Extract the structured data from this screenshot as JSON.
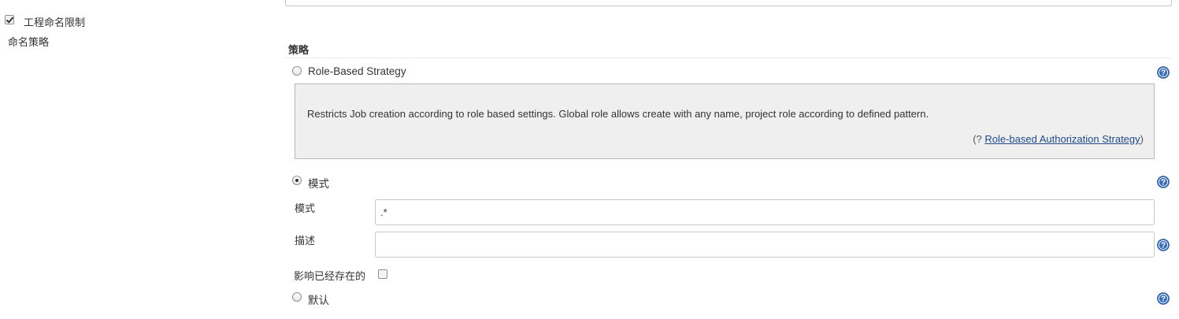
{
  "left_panel": {
    "checkbox_label": "工程命名限制",
    "checkbox_checked": true,
    "strategy_label": "命名策略"
  },
  "strategy": {
    "section_title": "策略",
    "options": [
      {
        "label": "Role-Based Strategy",
        "selected": false
      },
      {
        "label": "模式",
        "selected": true
      },
      {
        "label": "默认",
        "selected": false
      }
    ],
    "role_based_description": "Restricts Job creation according to role based settings. Global role allows create with any name, project role according to defined pattern.",
    "plugin_prefix": "(? ",
    "plugin_link": "Role-based Authorization Strategy",
    "plugin_suffix": ")",
    "pattern": {
      "pattern_label": "模式",
      "pattern_value": ".*",
      "description_label": "描述",
      "description_value": "",
      "affect_existing_label": "影响已经存在的",
      "affect_existing_checked": false
    }
  },
  "icons": {
    "help": "help-icon",
    "accent": "#3b6fb6"
  }
}
